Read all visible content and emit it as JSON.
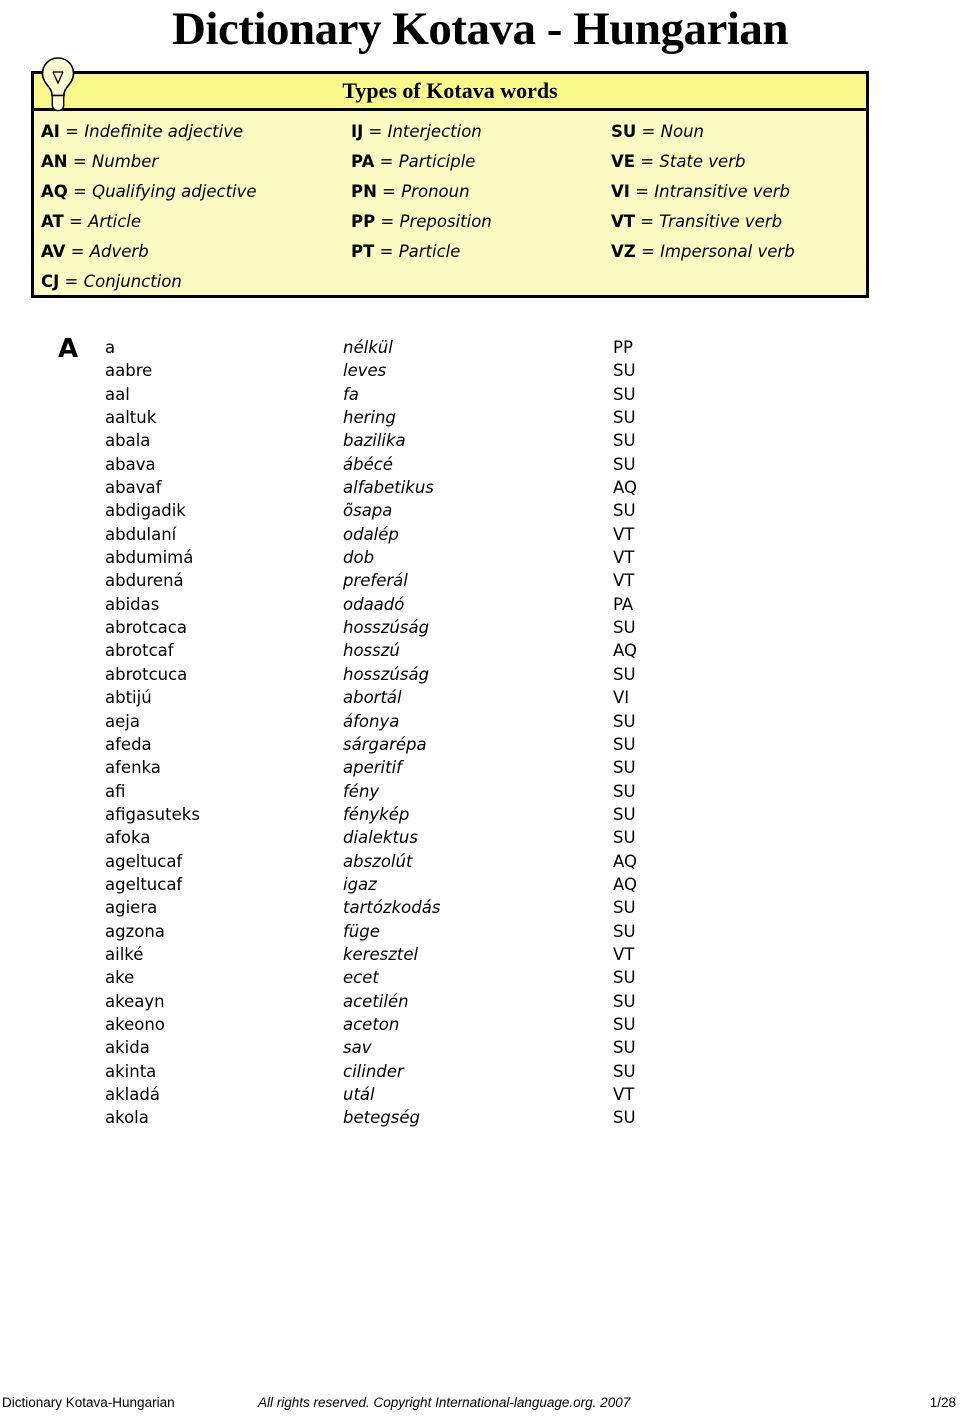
{
  "title": "Dictionary Kotava - Hungarian",
  "legend": {
    "icon": "lightbulb-icon",
    "header": "Types of Kotava words",
    "background_color": "#FBFBC4",
    "header_color": "#FAFA8C",
    "columns": [
      [
        {
          "code": "AI",
          "eq": "=",
          "def": "Indefinite adjective"
        },
        {
          "code": "AN",
          "eq": "=",
          "def": "Number"
        },
        {
          "code": "AQ",
          "eq": "=",
          "def": "Qualifying adjective"
        },
        {
          "code": "AT",
          "eq": "=",
          "def": "Article"
        },
        {
          "code": "AV",
          "eq": "=",
          "def": "Adverb"
        },
        {
          "code": "CJ",
          "eq": "=",
          "def": "Conjunction"
        }
      ],
      [
        {
          "code": "IJ",
          "eq": "=",
          "def": "Interjection"
        },
        {
          "code": "PA",
          "eq": "=",
          "def": "Participle"
        },
        {
          "code": "PN",
          "eq": "=",
          "def": "Pronoun"
        },
        {
          "code": "PP",
          "eq": "=",
          "def": "Preposition"
        },
        {
          "code": "PT",
          "eq": "=",
          "def": "Particle"
        }
      ],
      [
        {
          "code": "SU",
          "eq": "=",
          "def": "Noun"
        },
        {
          "code": "VE",
          "eq": "=",
          "def": "State verb"
        },
        {
          "code": "VI",
          "eq": "=",
          "def": "Intransitive verb"
        },
        {
          "code": "VT",
          "eq": "=",
          "def": "Transitive verb"
        },
        {
          "code": "VZ",
          "eq": "=",
          "def": "Impersonal verb"
        }
      ]
    ]
  },
  "entries": {
    "letter": "A",
    "rows": [
      {
        "kotava": "a",
        "hungarian": "nélkül",
        "type": "PP"
      },
      {
        "kotava": "aabre",
        "hungarian": "leves",
        "type": "SU"
      },
      {
        "kotava": "aal",
        "hungarian": "fa",
        "type": "SU"
      },
      {
        "kotava": "aaltuk",
        "hungarian": "hering",
        "type": "SU"
      },
      {
        "kotava": "abala",
        "hungarian": "bazilika",
        "type": "SU"
      },
      {
        "kotava": "abava",
        "hungarian": "ábécé",
        "type": "SU"
      },
      {
        "kotava": "abavaf",
        "hungarian": "alfabetikus",
        "type": "AQ"
      },
      {
        "kotava": "abdigadik",
        "hungarian": "õsapa",
        "type": "SU"
      },
      {
        "kotava": "abdulaní",
        "hungarian": "odalép",
        "type": "VT"
      },
      {
        "kotava": "abdumimá",
        "hungarian": "dob",
        "type": "VT"
      },
      {
        "kotava": "abdurená",
        "hungarian": "preferál",
        "type": "VT"
      },
      {
        "kotava": "abidas",
        "hungarian": "odaadó",
        "type": "PA"
      },
      {
        "kotava": "abrotcaca",
        "hungarian": "hosszúság",
        "type": "SU"
      },
      {
        "kotava": "abrotcaf",
        "hungarian": "hosszú",
        "type": "AQ"
      },
      {
        "kotava": "abrotcuca",
        "hungarian": "hosszúság",
        "type": "SU"
      },
      {
        "kotava": "abtijú",
        "hungarian": "abortál",
        "type": "VI"
      },
      {
        "kotava": "aeja",
        "hungarian": "áfonya",
        "type": "SU"
      },
      {
        "kotava": "afeda",
        "hungarian": "sárgarépa",
        "type": "SU"
      },
      {
        "kotava": "afenka",
        "hungarian": "aperitif",
        "type": "SU"
      },
      {
        "kotava": "afi",
        "hungarian": "fény",
        "type": "SU"
      },
      {
        "kotava": "afigasuteks",
        "hungarian": "fénykép",
        "type": "SU"
      },
      {
        "kotava": "afoka",
        "hungarian": "dialektus",
        "type": "SU"
      },
      {
        "kotava": "ageltucaf",
        "hungarian": "abszolút",
        "type": "AQ"
      },
      {
        "kotava": "ageltucaf",
        "hungarian": "igaz",
        "type": "AQ"
      },
      {
        "kotava": "agiera",
        "hungarian": "tartózkodás",
        "type": "SU"
      },
      {
        "kotava": "agzona",
        "hungarian": "füge",
        "type": "SU"
      },
      {
        "kotava": "ailké",
        "hungarian": "keresztel",
        "type": "VT"
      },
      {
        "kotava": "ake",
        "hungarian": "ecet",
        "type": "SU"
      },
      {
        "kotava": "akeayn",
        "hungarian": "acetilén",
        "type": "SU"
      },
      {
        "kotava": "akeono",
        "hungarian": "aceton",
        "type": "SU"
      },
      {
        "kotava": "akida",
        "hungarian": "sav",
        "type": "SU"
      },
      {
        "kotava": "akinta",
        "hungarian": "cilinder",
        "type": "SU"
      },
      {
        "kotava": "akladá",
        "hungarian": "utál",
        "type": "VT"
      },
      {
        "kotava": "akola",
        "hungarian": "betegség",
        "type": "SU"
      }
    ]
  },
  "footer": {
    "left": "Dictionary Kotava-Hungarian",
    "center": "All rights reserved. Copyright International-language.org. 2007",
    "right": "1/28"
  }
}
